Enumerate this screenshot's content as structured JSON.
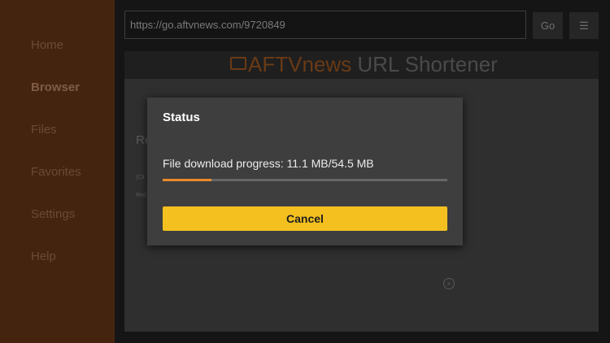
{
  "sidebar": {
    "items": [
      {
        "label": "Home"
      },
      {
        "label": "Browser"
      },
      {
        "label": "Files"
      },
      {
        "label": "Favorites"
      },
      {
        "label": "Settings"
      },
      {
        "label": "Help"
      }
    ],
    "active": "Browser"
  },
  "toolbar": {
    "url": "https://go.aftvnews.com/9720849",
    "go_label": "Go",
    "menu_icon": "☰"
  },
  "webpage": {
    "title_brand": "AFTVnews",
    "title_rest": " URL Shortener",
    "bg_heading": "Re",
    "bg_line1": "(Cli",
    "bg_line2": "Red"
  },
  "dialog": {
    "title": "Status",
    "progress_text": "File download progress: 11.1 MB/54.5 MB",
    "progress_fraction": 0.17,
    "cancel_label": "Cancel"
  },
  "colors": {
    "accent": "#f4c01f",
    "progress": "#e98a2c",
    "sidebar": "#45240f"
  }
}
